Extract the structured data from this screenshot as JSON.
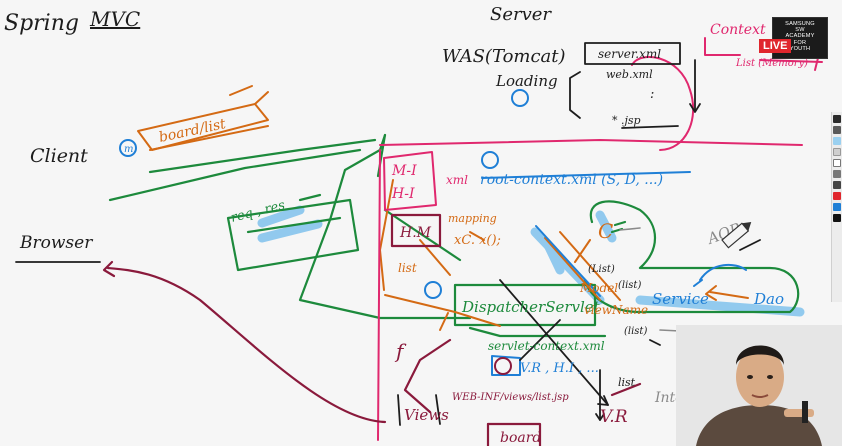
{
  "title": {
    "spring": "Spring",
    "mvc": "MVC"
  },
  "left": {
    "client": "Client",
    "browser": "Browser"
  },
  "server": {
    "label": "Server",
    "was": "WAS(Tomcat)",
    "loading": "Loading",
    "server_xml": "server.xml",
    "web_xml": "web.xml",
    "dots": ":",
    "star_jsp": "* .jsp"
  },
  "context": {
    "label": "Context",
    "list": "List (Memory)"
  },
  "request": {
    "board_list": "board/list",
    "req_res": "req , res",
    "circle_marker": "m"
  },
  "container": {
    "mi": "M-I",
    "hi": "H-I",
    "xml_label": "xml",
    "root_context": "root-context.xml (S, D, ...)",
    "hm": "H.M",
    "mapping": "mapping",
    "xc": "xC. x();",
    "list_upper": "list",
    "dispatcher": "DispatcherServlet",
    "servlet_context": "servlet-context.xml",
    "vr_line": "V.R , H.I , ...",
    "c_label": "C",
    "list_small": "(List)",
    "model": "Model",
    "view_name": "viewName",
    "list_paren": "(list)",
    "list_after": "(list)",
    "service": "Service",
    "dao": "Dao",
    "aop": "AOP",
    "f_letter": "f",
    "views": "Views",
    "jsp_path": "WEB-INF/views/list.jsp",
    "vr_big": "V.R",
    "interceptor": "Interceptor",
    "list_down": "list",
    "board": "board"
  },
  "stream": {
    "live": "LIVE",
    "brand_lines": [
      "SAMSUNG",
      "SW",
      "ACADEMY",
      "FOR",
      "YOUTH"
    ]
  },
  "toolbar": {
    "tools": [
      "pen-tool-icon",
      "marker-tool-icon",
      "highlighter-tool-icon",
      "eraser-tool-icon",
      "shape-tool-icon",
      "select-tool-icon",
      "undo-icon",
      "color-red-icon",
      "color-blue-icon",
      "color-black-icon"
    ]
  },
  "colors": {
    "ink_black": "#1d1d1d",
    "ink_orange": "#d46a14",
    "ink_green": "#1d8a3c",
    "ink_blue": "#1f7fd6",
    "ink_pink": "#e0286e",
    "ink_maroon": "#8a1a3c",
    "highlight_blue": "#3fa6e8",
    "live_red": "#e0262d"
  }
}
